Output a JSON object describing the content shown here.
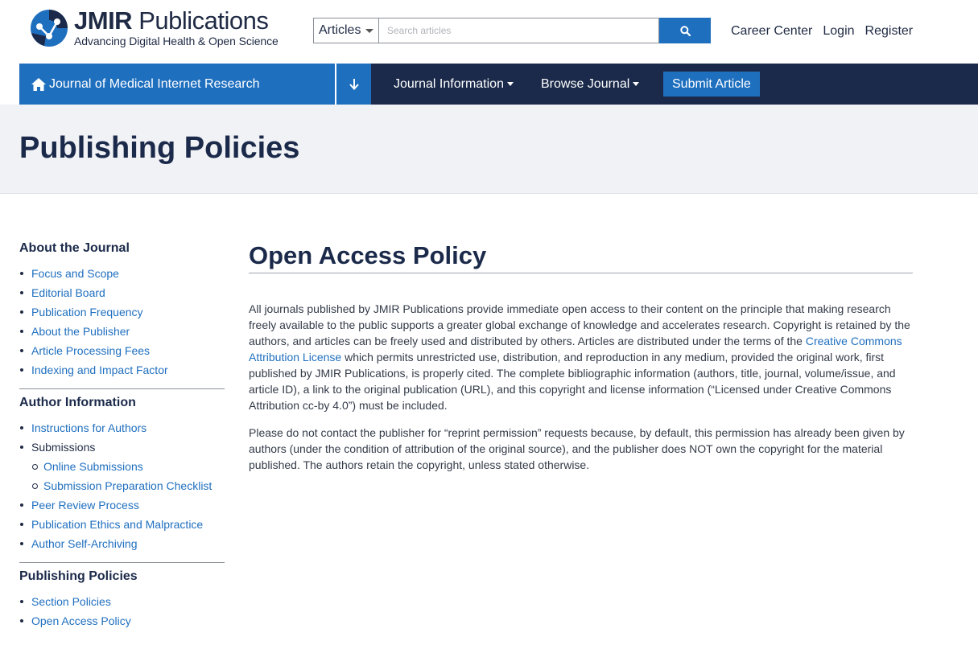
{
  "brand": {
    "name_bold": "JMIR",
    "name_rest": " Publications",
    "tagline": "Advancing Digital Health & Open Science",
    "colors": {
      "primary": "#1f6fbf",
      "navy": "#1b2a4a"
    }
  },
  "search": {
    "scope": "Articles",
    "placeholder": "Search articles",
    "button_icon": "search-icon"
  },
  "toplinks": [
    "Career Center",
    "Login",
    "Register"
  ],
  "nav": {
    "journal": "Journal of Medical Internet Research",
    "journal_information": "Journal Information",
    "browse_journal": "Browse Journal",
    "submit_article": "Submit Article"
  },
  "page_title": "Publishing Policies",
  "sidebar": {
    "sections": [
      {
        "title": "About the Journal",
        "items": [
          "Focus and Scope",
          "Editorial Board",
          "Publication Frequency",
          "About the Publisher",
          "Article Processing Fees",
          "Indexing and Impact Factor"
        ]
      },
      {
        "title": "Author Information",
        "items": [
          "Instructions for Authors",
          "Submissions",
          "Online Submissions",
          "Submission Preparation Checklist",
          "Peer Review Process",
          "Publication Ethics and Malpractice",
          "Author Self-Archiving"
        ]
      },
      {
        "title": "Publishing Policies",
        "items": [
          "Section Policies",
          "Open Access Policy"
        ]
      }
    ]
  },
  "article": {
    "heading": "Open Access Policy",
    "p1_a": "All journals published by JMIR Publications provide immediate open access to their content on the principle that making research freely available to the public supports a greater global exchange of knowledge and accelerates research. Copyright is retained by the authors, and articles can be freely used and distributed by others. Articles are distributed under the terms of the ",
    "p1_link": "Creative Commons Attribution License",
    "p1_b": " which permits unrestricted use, distribution, and reproduction in any medium, provided the original work, first published by JMIR Publications, is properly cited. The complete bibliographic information (authors, title, journal, volume/issue, and article ID), a link to the original publication (URL), and this copyright and license information (“Licensed under Creative Commons Attribution cc-by 4.0”) must be included.",
    "p2": "Please do not contact the publisher for “reprint permission” requests because, by default, this permission has already been given by authors (under the condition of attribution of the original source), and the publisher does NOT own the copyright for the material published. The authors retain the copyright, unless stated otherwise."
  }
}
